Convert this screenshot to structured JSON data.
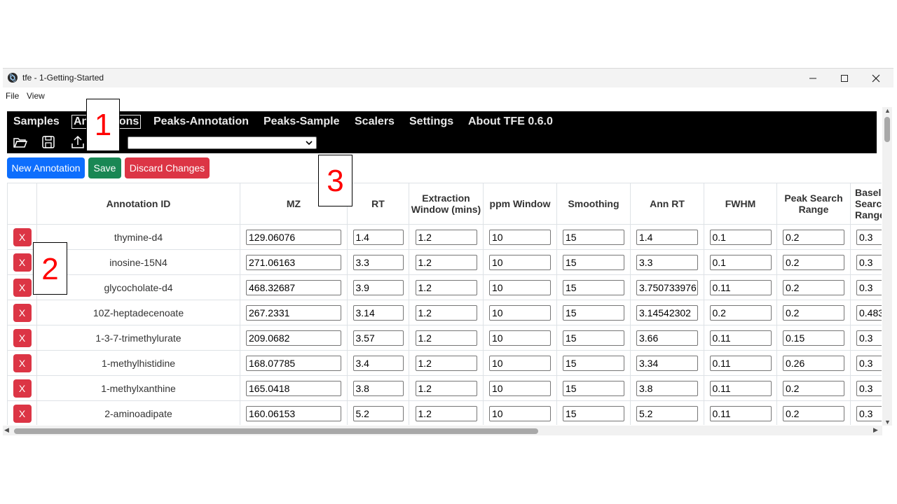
{
  "window": {
    "title": "tfe - 1-Getting-Started",
    "controls": {
      "minimize": "—",
      "maximize": "☐",
      "close": "✕"
    }
  },
  "menu": [
    "File",
    "View"
  ],
  "nav": {
    "tabs": [
      "Samples",
      "Annotations",
      "Peaks-Annotation",
      "Peaks-Sample",
      "Scalers",
      "Settings",
      "About TFE 0.6.0"
    ],
    "active_tab": "Annotations",
    "select_value": ""
  },
  "toolbar": {
    "new_annotation": "New Annotation",
    "save": "Save",
    "discard": "Discard Changes"
  },
  "table": {
    "headers": [
      "",
      "Annotation ID",
      "MZ",
      "RT",
      "Extraction Window (mins)",
      "ppm Window",
      "Smoothing",
      "Ann RT",
      "FWHM",
      "Peak Search Range",
      "Baseline Search Range"
    ],
    "rows": [
      {
        "id": "thymine-d4",
        "mz": "129.06076",
        "rt": "1.4",
        "ext": "1.2",
        "ppm": "10",
        "smooth": "15",
        "annrt": "1.4",
        "fwhm": "0.1",
        "psr": "0.2",
        "bsr": "0.3"
      },
      {
        "id": "inosine-15N4",
        "mz": "271.06163",
        "rt": "3.3",
        "ext": "1.2",
        "ppm": "10",
        "smooth": "15",
        "annrt": "3.3",
        "fwhm": "0.1",
        "psr": "0.2",
        "bsr": "0.3"
      },
      {
        "id": "glycocholate-d4",
        "mz": "468.32687",
        "rt": "3.9",
        "ext": "1.2",
        "ppm": "10",
        "smooth": "15",
        "annrt": "3.750733976",
        "fwhm": "0.11",
        "psr": "0.2",
        "bsr": "0.3"
      },
      {
        "id": "10Z-heptadecenoate",
        "mz": "267.2331",
        "rt": "3.14",
        "ext": "1.2",
        "ppm": "10",
        "smooth": "15",
        "annrt": "3.14542302",
        "fwhm": "0.2",
        "psr": "0.2",
        "bsr": "0.483"
      },
      {
        "id": "1-3-7-trimethylurate",
        "mz": "209.0682",
        "rt": "3.57",
        "ext": "1.2",
        "ppm": "10",
        "smooth": "15",
        "annrt": "3.66",
        "fwhm": "0.11",
        "psr": "0.15",
        "bsr": "0.3"
      },
      {
        "id": "1-methylhistidine",
        "mz": "168.07785",
        "rt": "3.4",
        "ext": "1.2",
        "ppm": "10",
        "smooth": "15",
        "annrt": "3.34",
        "fwhm": "0.11",
        "psr": "0.26",
        "bsr": "0.3"
      },
      {
        "id": "1-methylxanthine",
        "mz": "165.0418",
        "rt": "3.8",
        "ext": "1.2",
        "ppm": "10",
        "smooth": "15",
        "annrt": "3.8",
        "fwhm": "0.11",
        "psr": "0.2",
        "bsr": "0.3"
      },
      {
        "id": "2-aminoadipate",
        "mz": "160.06153",
        "rt": "5.2",
        "ext": "1.2",
        "ppm": "10",
        "smooth": "15",
        "annrt": "5.2",
        "fwhm": "0.11",
        "psr": "0.2",
        "bsr": "0.3"
      }
    ],
    "delete_label": "X"
  },
  "callouts": [
    "1",
    "2",
    "3"
  ]
}
